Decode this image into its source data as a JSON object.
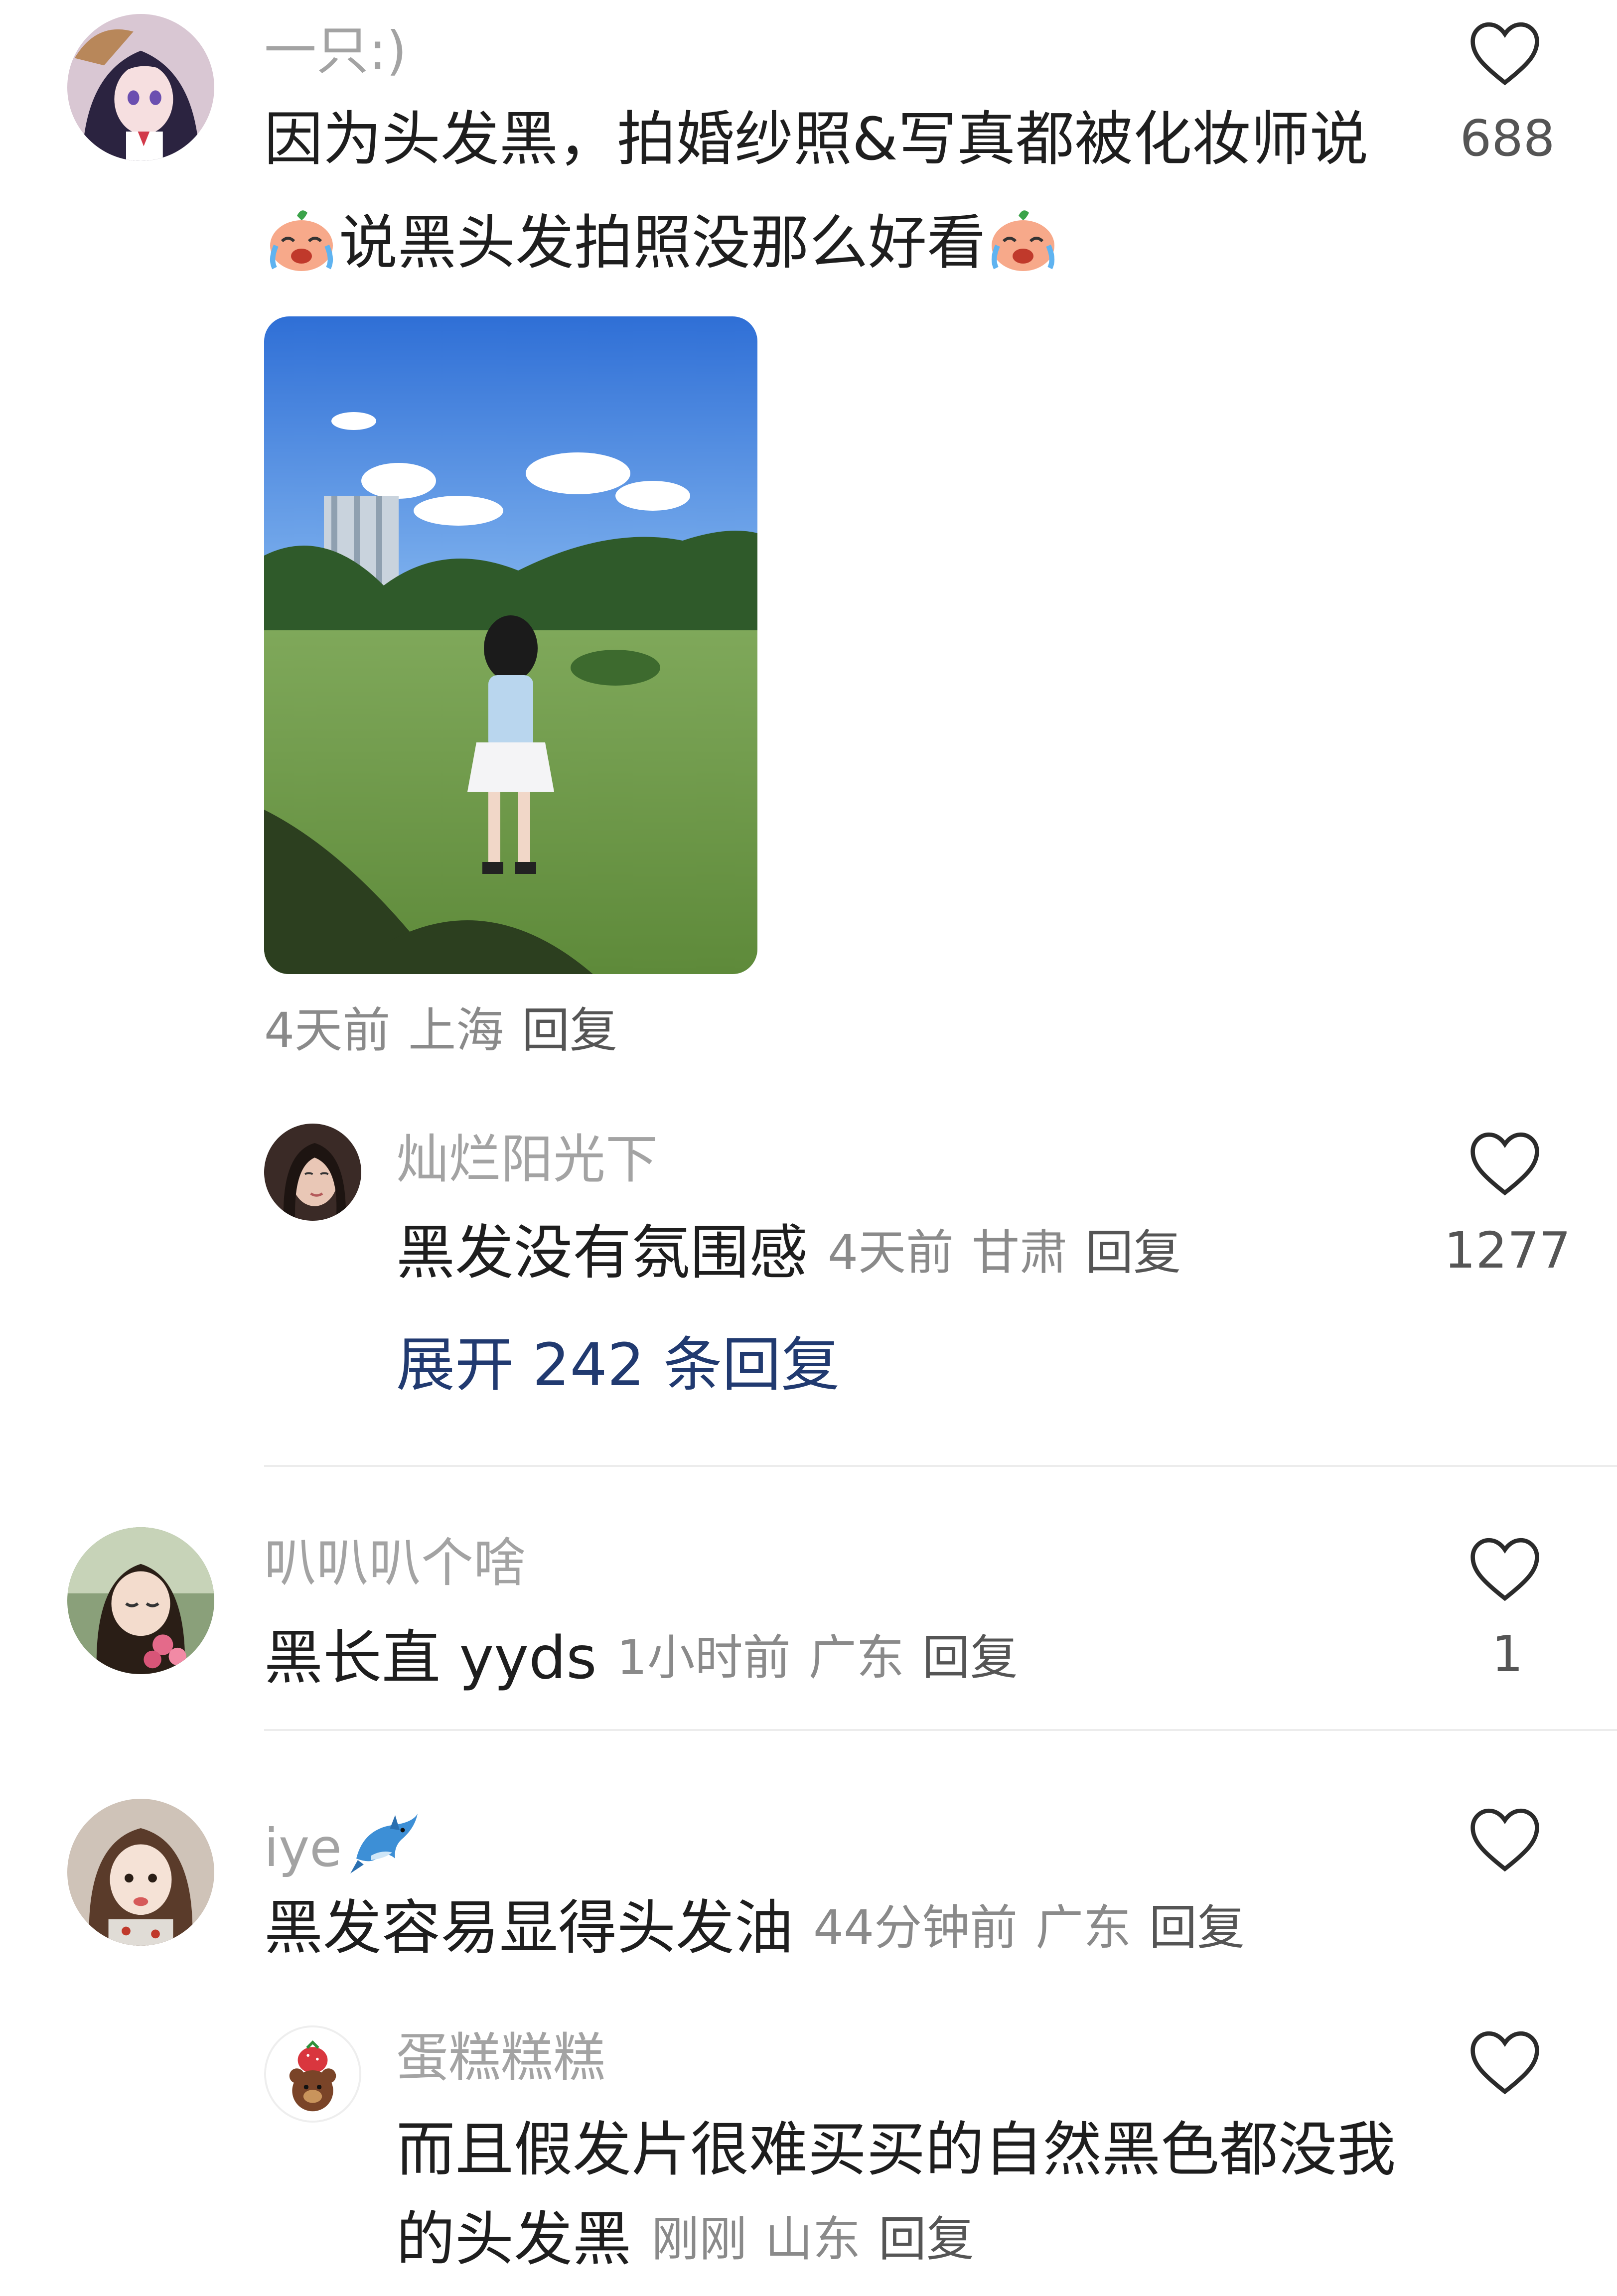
{
  "comments": [
    {
      "author": "一只:)",
      "text_line1": "因为头发黑，拍婚纱照&写真都被化妆师说",
      "text_line2": "说黑头发拍照没那么好看",
      "emoji_icon": "crying-laughing-tangerine-emoji",
      "photo_description_icon": "photo-girl-on-lawn",
      "time": "4天前",
      "location": "上海",
      "reply_label": "回复",
      "likes": "688"
    },
    {
      "author": "灿烂阳光下",
      "text": "黑发没有氛围感",
      "time": "4天前",
      "location": "甘肃",
      "reply_label": "回复",
      "likes": "1277"
    },
    {
      "author": "叭叭叭个啥",
      "text": "黑长直 yyds",
      "time": "1小时前",
      "location": "广东",
      "reply_label": "回复",
      "likes": "1"
    },
    {
      "author": "iye",
      "author_emoji_icon": "dolphin-emoji",
      "text": "黑发容易显得头发油",
      "time": "44分钟前",
      "location": "广东",
      "reply_label": "回复",
      "likes": ""
    },
    {
      "author": "蛋糕糕糕",
      "text_line1": "而且假发片很难买买的自然黑色都没我",
      "text_line2": "的头发黑",
      "time": "刚刚",
      "location": "山东",
      "reply_label": "回复",
      "likes": ""
    }
  ],
  "expand_replies": "展开 242 条回复",
  "colors": {
    "name": "#a3a3a3",
    "text": "#1e1e1e",
    "meta": "#8a8a8a",
    "expand": "#213a70",
    "divider": "#ececec"
  }
}
